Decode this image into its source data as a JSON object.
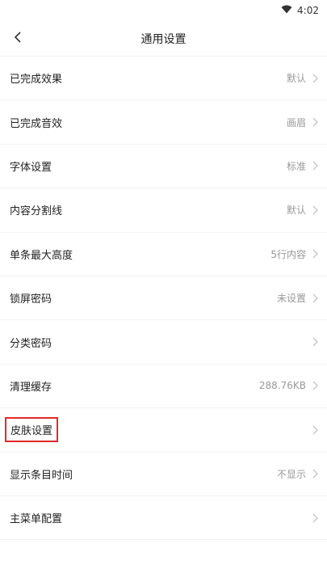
{
  "status_bar": {
    "time": "4:02",
    "icons": [
      "wifi-icon"
    ]
  },
  "header": {
    "back_icon": "chevron-left-icon",
    "title": "通用设置"
  },
  "settings": [
    {
      "label": "已完成效果",
      "value": "默认"
    },
    {
      "label": "已完成音效",
      "value": "画眉"
    },
    {
      "label": "字体设置",
      "value": "标准"
    },
    {
      "label": "内容分割线",
      "value": "默认"
    },
    {
      "label": "单条最大高度",
      "value": "5行内容"
    },
    {
      "label": "锁屏密码",
      "value": "未设置"
    },
    {
      "label": "分类密码",
      "value": ""
    },
    {
      "label": "清理缓存",
      "value": "288.76KB"
    },
    {
      "label": "皮肤设置",
      "value": "",
      "highlighted": true
    },
    {
      "label": "显示条目时间",
      "value": "不显示"
    },
    {
      "label": "主菜单配置",
      "value": ""
    }
  ],
  "colors": {
    "highlight_border": "#e32929",
    "value_text": "#999999",
    "divider": "#f2f2f2"
  }
}
